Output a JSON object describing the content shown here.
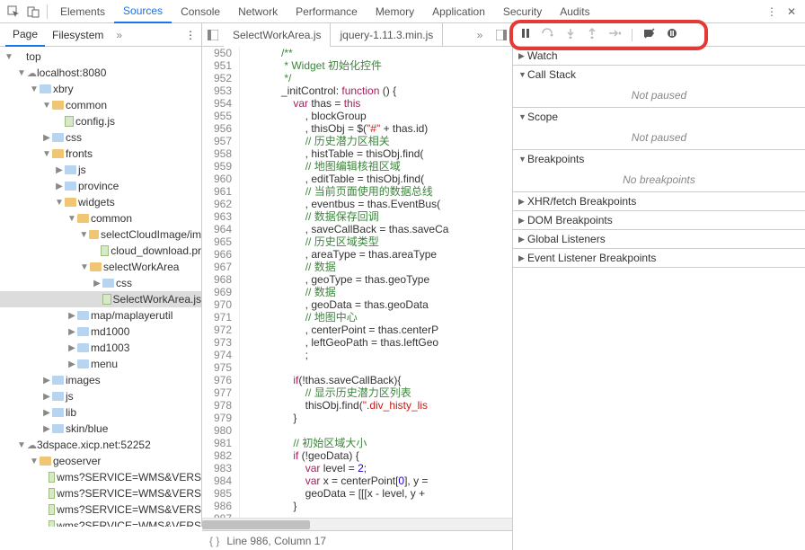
{
  "topTabs": {
    "elements": "Elements",
    "sources": "Sources",
    "console": "Console",
    "network": "Network",
    "performance": "Performance",
    "memory": "Memory",
    "application": "Application",
    "security": "Security",
    "audits": "Audits"
  },
  "leftTabs": {
    "page": "Page",
    "filesystem": "Filesystem"
  },
  "tree": {
    "top": "top",
    "host1": "localhost:8080",
    "xbry": "xbry",
    "common": "common",
    "configjs": "config.js",
    "css": "css",
    "fronts": "fronts",
    "js": "js",
    "province": "province",
    "widgets": "widgets",
    "common2": "common",
    "selectCloud": "selectCloudImage/im",
    "cloud_download": "cloud_download.pr",
    "selectWorkArea": "selectWorkArea",
    "css2": "css",
    "selectWorkAreaJs": "SelectWorkArea.js",
    "maplayer": "map/maplayerutil",
    "md1000": "md1000",
    "md1003": "md1003",
    "menu": "menu",
    "images": "images",
    "js2": "js",
    "lib": "lib",
    "skinblue": "skin/blue",
    "host2": "3dspace.xicp.net:52252",
    "geoserver": "geoserver",
    "wms1": "wms?SERVICE=WMS&VERS",
    "wms2": "wms?SERVICE=WMS&VERS",
    "wms3": "wms?SERVICE=WMS&VERS",
    "wms4": "wms?SERVICE=WMS&VERS"
  },
  "fileTabs": {
    "t1": "SelectWorkArea.js",
    "t2": "jquery-1.11.3.min.js"
  },
  "status": "Line 986, Column 17",
  "right": {
    "watch": "Watch",
    "callstack": "Call Stack",
    "notpaused": "Not paused",
    "scope": "Scope",
    "breakpoints": "Breakpoints",
    "nobp": "No breakpoints",
    "xhr": "XHR/fetch Breakpoints",
    "dom": "DOM Breakpoints",
    "global": "Global Listeners",
    "event": "Event Listener Breakpoints"
  },
  "code": {
    "startLine": 950,
    "lines": [
      {
        "t": [
          "            /**"
        ],
        "cls": [
          "c-cmt"
        ]
      },
      {
        "t": [
          "             * Widget 初始化控件"
        ],
        "cls": [
          "c-cmt"
        ]
      },
      {
        "t": [
          "             */"
        ],
        "cls": [
          "c-cmt"
        ]
      },
      {
        "t": [
          "            _initControl: ",
          "function",
          " () {"
        ],
        "cls": [
          "",
          "c-kw",
          ""
        ]
      },
      {
        "t": [
          "                ",
          "var",
          " thas = ",
          "this"
        ],
        "cls": [
          "",
          "c-kw",
          "",
          "c-kw"
        ]
      },
      {
        "t": [
          "                    , blockGroup"
        ],
        "cls": [
          ""
        ]
      },
      {
        "t": [
          "                    , thisObj = $(",
          "\"#\"",
          " + thas.id)"
        ],
        "cls": [
          "",
          "c-str",
          ""
        ]
      },
      {
        "t": [
          "                    ",
          "// 历史潜力区相关"
        ],
        "cls": [
          "",
          "c-cmt"
        ]
      },
      {
        "t": [
          "                    , histTable = thisObj.find("
        ],
        "cls": [
          ""
        ]
      },
      {
        "t": [
          "                    ",
          "// 地图编辑核祖区域"
        ],
        "cls": [
          "",
          "c-cmt"
        ]
      },
      {
        "t": [
          "                    , editTable = thisObj.find("
        ],
        "cls": [
          ""
        ]
      },
      {
        "t": [
          "                    ",
          "// 当前页面使用的数据总线"
        ],
        "cls": [
          "",
          "c-cmt"
        ]
      },
      {
        "t": [
          "                    , eventbus = thas.EventBus("
        ],
        "cls": [
          ""
        ]
      },
      {
        "t": [
          "                    ",
          "// 数据保存回调"
        ],
        "cls": [
          "",
          "c-cmt"
        ]
      },
      {
        "t": [
          "                    , saveCallBack = thas.saveCa"
        ],
        "cls": [
          ""
        ]
      },
      {
        "t": [
          "                    ",
          "// 历史区域类型"
        ],
        "cls": [
          "",
          "c-cmt"
        ]
      },
      {
        "t": [
          "                    , areaType = thas.areaType"
        ],
        "cls": [
          ""
        ]
      },
      {
        "t": [
          "                    ",
          "// 数据"
        ],
        "cls": [
          "",
          "c-cmt"
        ]
      },
      {
        "t": [
          "                    , geoType = thas.geoType"
        ],
        "cls": [
          ""
        ]
      },
      {
        "t": [
          "                    ",
          "// 数据"
        ],
        "cls": [
          "",
          "c-cmt"
        ]
      },
      {
        "t": [
          "                    , geoData = thas.geoData"
        ],
        "cls": [
          ""
        ]
      },
      {
        "t": [
          "                    ",
          "// 地图中心"
        ],
        "cls": [
          "",
          "c-cmt"
        ]
      },
      {
        "t": [
          "                    , centerPoint = thas.centerP"
        ],
        "cls": [
          ""
        ]
      },
      {
        "t": [
          "                    , leftGeoPath = thas.leftGeo"
        ],
        "cls": [
          ""
        ]
      },
      {
        "t": [
          "                    ;"
        ],
        "cls": [
          ""
        ]
      },
      {
        "t": [
          ""
        ],
        "cls": [
          ""
        ]
      },
      {
        "t": [
          "                ",
          "if",
          "(!thas.saveCallBack){"
        ],
        "cls": [
          "",
          "c-kw",
          ""
        ]
      },
      {
        "t": [
          "                    ",
          "// 显示历史潜力区列表"
        ],
        "cls": [
          "",
          "c-cmt"
        ]
      },
      {
        "t": [
          "                    thisObj.find(",
          "\".div_histy_lis"
        ],
        "cls": [
          "",
          "c-str"
        ]
      },
      {
        "t": [
          "                }"
        ],
        "cls": [
          ""
        ]
      },
      {
        "t": [
          ""
        ],
        "cls": [
          ""
        ]
      },
      {
        "t": [
          "                ",
          "// 初始区域大小"
        ],
        "cls": [
          "",
          "c-cmt"
        ]
      },
      {
        "t": [
          "                ",
          "if",
          " (!geoData) {"
        ],
        "cls": [
          "",
          "c-kw",
          ""
        ]
      },
      {
        "t": [
          "                    ",
          "var",
          " level = ",
          "2",
          ";"
        ],
        "cls": [
          "",
          "c-kw",
          "",
          "c-num",
          ""
        ]
      },
      {
        "t": [
          "                    ",
          "var",
          " x = centerPoint[",
          "0",
          "], y ="
        ],
        "cls": [
          "",
          "c-kw",
          "",
          "c-num",
          ""
        ]
      },
      {
        "t": [
          "                    geoData = [[[x - level, y +"
        ],
        "cls": [
          ""
        ]
      },
      {
        "t": [
          "                }"
        ],
        "cls": [
          ""
        ]
      },
      {
        "t": [
          ""
        ],
        "cls": [
          ""
        ]
      }
    ]
  }
}
